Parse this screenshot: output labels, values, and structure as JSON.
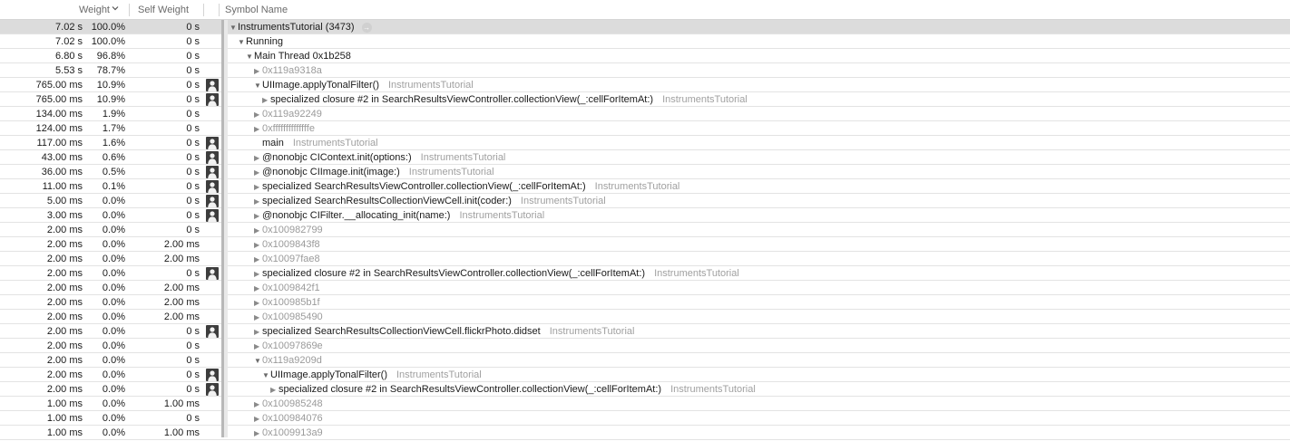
{
  "header": {
    "weight": "Weight",
    "self_weight": "Self Weight",
    "symbol_name": "Symbol Name"
  },
  "rows": [
    {
      "weight": "7.02 s",
      "pct": "100.0%",
      "self": "0 s",
      "icon": false,
      "depth": 0,
      "disclosure": "open",
      "name": "InstrumentsTutorial (3473)",
      "lib": "",
      "addr": false,
      "selected": true,
      "jump": true
    },
    {
      "weight": "7.02 s",
      "pct": "100.0%",
      "self": "0 s",
      "icon": false,
      "depth": 1,
      "disclosure": "open",
      "name": "Running",
      "lib": "",
      "addr": false
    },
    {
      "weight": "6.80 s",
      "pct": "96.8%",
      "self": "0 s",
      "icon": false,
      "depth": 2,
      "disclosure": "open",
      "name": "Main Thread  0x1b258",
      "lib": "",
      "addr": false
    },
    {
      "weight": "5.53 s",
      "pct": "78.7%",
      "self": "0 s",
      "icon": false,
      "depth": 3,
      "disclosure": "closed",
      "name": "0x119a9318a",
      "lib": "",
      "addr": true
    },
    {
      "weight": "765.00 ms",
      "pct": "10.9%",
      "self": "0 s",
      "icon": true,
      "depth": 3,
      "disclosure": "open",
      "name": "UIImage.applyTonalFilter()",
      "lib": "InstrumentsTutorial",
      "addr": false
    },
    {
      "weight": "765.00 ms",
      "pct": "10.9%",
      "self": "0 s",
      "icon": true,
      "depth": 4,
      "disclosure": "closed",
      "name": "specialized closure #2 in SearchResultsViewController.collectionView(_:cellForItemAt:)",
      "lib": "InstrumentsTutorial",
      "addr": false
    },
    {
      "weight": "134.00 ms",
      "pct": "1.9%",
      "self": "0 s",
      "icon": false,
      "depth": 3,
      "disclosure": "closed",
      "name": "0x119a92249",
      "lib": "",
      "addr": true
    },
    {
      "weight": "124.00 ms",
      "pct": "1.7%",
      "self": "0 s",
      "icon": false,
      "depth": 3,
      "disclosure": "closed",
      "name": "0xffffffffffffffe",
      "lib": "",
      "addr": true
    },
    {
      "weight": "117.00 ms",
      "pct": "1.6%",
      "self": "0 s",
      "icon": true,
      "depth": 3,
      "disclosure": "none",
      "name": "main",
      "lib": "InstrumentsTutorial",
      "addr": false
    },
    {
      "weight": "43.00 ms",
      "pct": "0.6%",
      "self": "0 s",
      "icon": true,
      "depth": 3,
      "disclosure": "closed",
      "name": "@nonobjc CIContext.init(options:)",
      "lib": "InstrumentsTutorial",
      "addr": false
    },
    {
      "weight": "36.00 ms",
      "pct": "0.5%",
      "self": "0 s",
      "icon": true,
      "depth": 3,
      "disclosure": "closed",
      "name": "@nonobjc CIImage.init(image:)",
      "lib": "InstrumentsTutorial",
      "addr": false
    },
    {
      "weight": "11.00 ms",
      "pct": "0.1%",
      "self": "0 s",
      "icon": true,
      "depth": 3,
      "disclosure": "closed",
      "name": "specialized SearchResultsViewController.collectionView(_:cellForItemAt:)",
      "lib": "InstrumentsTutorial",
      "addr": false
    },
    {
      "weight": "5.00 ms",
      "pct": "0.0%",
      "self": "0 s",
      "icon": true,
      "depth": 3,
      "disclosure": "closed",
      "name": "specialized SearchResultsCollectionViewCell.init(coder:)",
      "lib": "InstrumentsTutorial",
      "addr": false
    },
    {
      "weight": "3.00 ms",
      "pct": "0.0%",
      "self": "0 s",
      "icon": true,
      "depth": 3,
      "disclosure": "closed",
      "name": "@nonobjc CIFilter.__allocating_init(name:)",
      "lib": "InstrumentsTutorial",
      "addr": false
    },
    {
      "weight": "2.00 ms",
      "pct": "0.0%",
      "self": "0 s",
      "icon": false,
      "depth": 3,
      "disclosure": "closed",
      "name": "0x100982799",
      "lib": "",
      "addr": true
    },
    {
      "weight": "2.00 ms",
      "pct": "0.0%",
      "self": "2.00 ms",
      "icon": false,
      "depth": 3,
      "disclosure": "closed",
      "name": "0x1009843f8",
      "lib": "",
      "addr": true
    },
    {
      "weight": "2.00 ms",
      "pct": "0.0%",
      "self": "2.00 ms",
      "icon": false,
      "depth": 3,
      "disclosure": "closed",
      "name": "0x10097fae8",
      "lib": "",
      "addr": true
    },
    {
      "weight": "2.00 ms",
      "pct": "0.0%",
      "self": "0 s",
      "icon": true,
      "depth": 3,
      "disclosure": "closed",
      "name": "specialized closure #2 in SearchResultsViewController.collectionView(_:cellForItemAt:)",
      "lib": "InstrumentsTutorial",
      "addr": false
    },
    {
      "weight": "2.00 ms",
      "pct": "0.0%",
      "self": "2.00 ms",
      "icon": false,
      "depth": 3,
      "disclosure": "closed",
      "name": "0x1009842f1",
      "lib": "",
      "addr": true
    },
    {
      "weight": "2.00 ms",
      "pct": "0.0%",
      "self": "2.00 ms",
      "icon": false,
      "depth": 3,
      "disclosure": "closed",
      "name": "0x100985b1f",
      "lib": "",
      "addr": true
    },
    {
      "weight": "2.00 ms",
      "pct": "0.0%",
      "self": "2.00 ms",
      "icon": false,
      "depth": 3,
      "disclosure": "closed",
      "name": "0x100985490",
      "lib": "",
      "addr": true
    },
    {
      "weight": "2.00 ms",
      "pct": "0.0%",
      "self": "0 s",
      "icon": true,
      "depth": 3,
      "disclosure": "closed",
      "name": "specialized SearchResultsCollectionViewCell.flickrPhoto.didset",
      "lib": "InstrumentsTutorial",
      "addr": false
    },
    {
      "weight": "2.00 ms",
      "pct": "0.0%",
      "self": "0 s",
      "icon": false,
      "depth": 3,
      "disclosure": "closed",
      "name": "0x10097869e",
      "lib": "",
      "addr": true
    },
    {
      "weight": "2.00 ms",
      "pct": "0.0%",
      "self": "0 s",
      "icon": false,
      "depth": 3,
      "disclosure": "open",
      "name": "0x119a9209d",
      "lib": "",
      "addr": true
    },
    {
      "weight": "2.00 ms",
      "pct": "0.0%",
      "self": "0 s",
      "icon": true,
      "depth": 4,
      "disclosure": "open",
      "name": "UIImage.applyTonalFilter()",
      "lib": "InstrumentsTutorial",
      "addr": false
    },
    {
      "weight": "2.00 ms",
      "pct": "0.0%",
      "self": "0 s",
      "icon": true,
      "depth": 5,
      "disclosure": "closed",
      "name": "specialized closure #2 in SearchResultsViewController.collectionView(_:cellForItemAt:)",
      "lib": "InstrumentsTutorial",
      "addr": false
    },
    {
      "weight": "1.00 ms",
      "pct": "0.0%",
      "self": "1.00 ms",
      "icon": false,
      "depth": 3,
      "disclosure": "closed",
      "name": "0x100985248",
      "lib": "",
      "addr": true
    },
    {
      "weight": "1.00 ms",
      "pct": "0.0%",
      "self": "0 s",
      "icon": false,
      "depth": 3,
      "disclosure": "closed",
      "name": "0x100984076",
      "lib": "",
      "addr": true
    },
    {
      "weight": "1.00 ms",
      "pct": "0.0%",
      "self": "1.00 ms",
      "icon": false,
      "depth": 3,
      "disclosure": "closed",
      "name": "0x1009913a9",
      "lib": "",
      "addr": true
    }
  ]
}
